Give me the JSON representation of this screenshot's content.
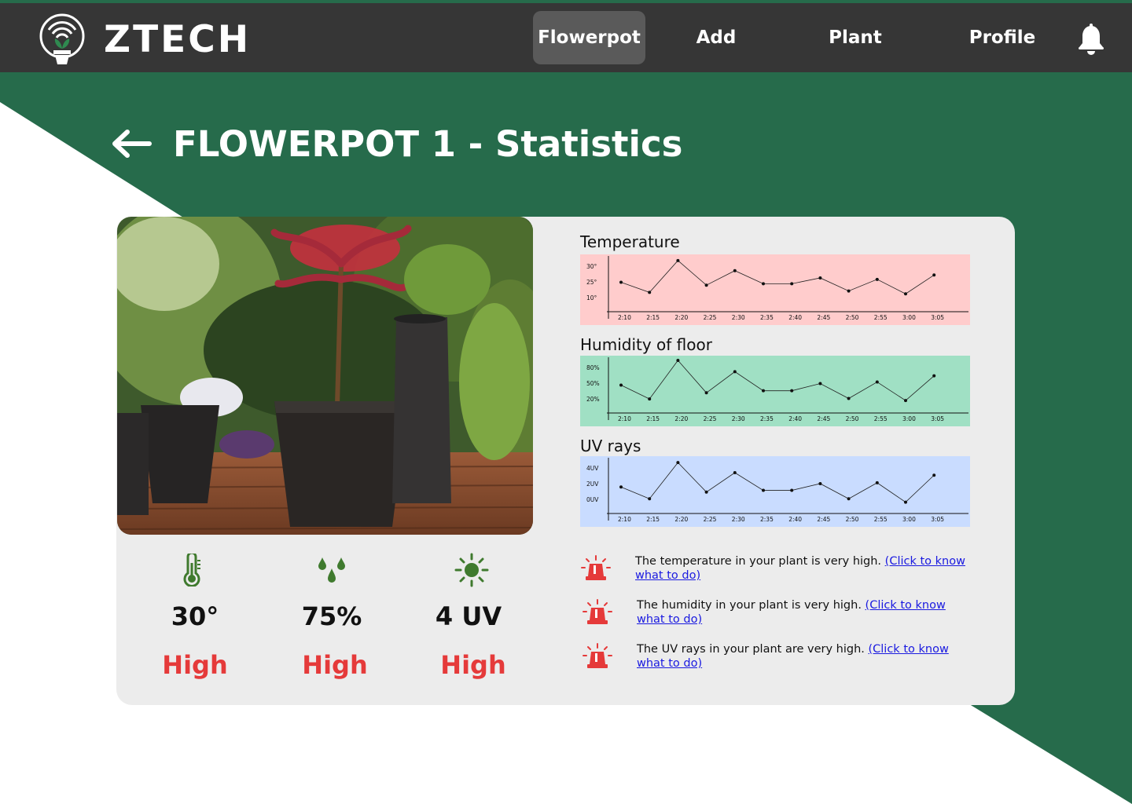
{
  "brand": {
    "name": "ZTECH",
    "logo_icon": "smart-plant-logo-icon"
  },
  "nav": {
    "items": [
      {
        "label": "Flowerpot",
        "active": true
      },
      {
        "label": "Add",
        "active": false
      },
      {
        "label": "Plant",
        "active": false
      },
      {
        "label": "Profile",
        "active": false
      }
    ],
    "notification_icon": "bell-icon"
  },
  "page": {
    "title": "FLOWERPOT 1 - Statistics",
    "back_icon": "arrow-left-icon"
  },
  "colors": {
    "green": "#266b4b",
    "navbar": "#363636",
    "alert_red": "#e53a3a",
    "icon_green": "#3f7a2e",
    "link_blue": "#1a1ae0",
    "temperature_bg": "#ffcccc",
    "humidity_bg": "#a0e0c4",
    "uv_bg": "#c9dcff"
  },
  "stats": [
    {
      "icon": "thermometer-icon",
      "value": "30°",
      "status": "High"
    },
    {
      "icon": "water-drops-icon",
      "value": "75%",
      "status": "High"
    },
    {
      "icon": "sun-icon",
      "value": "4 UV",
      "status": "High"
    }
  ],
  "charts": {
    "x_labels": [
      "2:10",
      "2:15",
      "2:20",
      "2:25",
      "2:30",
      "2:35",
      "2:40",
      "2:45",
      "2:50",
      "2:55",
      "3:00",
      "3:05"
    ],
    "temperature": {
      "title": "Temperature",
      "y_labels": [
        "30°",
        "25°",
        "10°"
      ]
    },
    "humidity": {
      "title": "Humidity of floor",
      "y_labels": [
        "80%",
        "50%",
        "20%"
      ]
    },
    "uv": {
      "title": "UV rays",
      "y_labels": [
        "4UV",
        "2UV",
        "0UV"
      ]
    }
  },
  "chart_data": [
    {
      "type": "line",
      "title": "Temperature",
      "x": [
        "2:10",
        "2:15",
        "2:20",
        "2:25",
        "2:30",
        "2:35",
        "2:40",
        "2:45",
        "2:50",
        "2:55",
        "3:00",
        "3:05"
      ],
      "y_ticks": [
        "30°",
        "25°",
        "10°"
      ],
      "values": [
        16,
        9,
        31,
        14,
        24,
        15,
        15,
        19,
        10,
        18,
        8,
        21
      ],
      "ylim": [
        0,
        32
      ],
      "grid": false,
      "background": "#ffcccc"
    },
    {
      "type": "line",
      "title": "Humidity of floor",
      "x": [
        "2:10",
        "2:15",
        "2:20",
        "2:25",
        "2:30",
        "2:35",
        "2:40",
        "2:45",
        "2:50",
        "2:55",
        "3:00",
        "3:05"
      ],
      "y_ticks": [
        "80%",
        "50%",
        "20%"
      ],
      "values": [
        42,
        15,
        90,
        27,
        68,
        31,
        31,
        45,
        16,
        48,
        12,
        60
      ],
      "ylim": [
        0,
        90
      ],
      "grid": false,
      "background": "#a0e0c4"
    },
    {
      "type": "line",
      "title": "UV rays",
      "x": [
        "2:10",
        "2:15",
        "2:20",
        "2:25",
        "2:30",
        "2:35",
        "2:40",
        "2:45",
        "2:50",
        "2:55",
        "3:00",
        "3:05"
      ],
      "y_ticks": [
        "4UV",
        "2UV",
        "0UV"
      ],
      "values": [
        2.4,
        1.0,
        5.3,
        1.8,
        4.1,
        2.0,
        2.0,
        2.8,
        1.0,
        2.9,
        0.6,
        3.8
      ],
      "ylim": [
        0,
        5.5
      ],
      "grid": false,
      "background": "#c9dcff"
    }
  ],
  "alerts": [
    {
      "icon": "siren-icon",
      "text": "The temperature in your plant is very high.",
      "link": "(Click to know what to do)"
    },
    {
      "icon": "siren-icon",
      "text": "The humidity in your plant is very high.",
      "link": "(Click to know what to do)"
    },
    {
      "icon": "siren-icon",
      "text": "The UV rays in your plant are very high.",
      "link": "(Click to know what to do)"
    }
  ]
}
